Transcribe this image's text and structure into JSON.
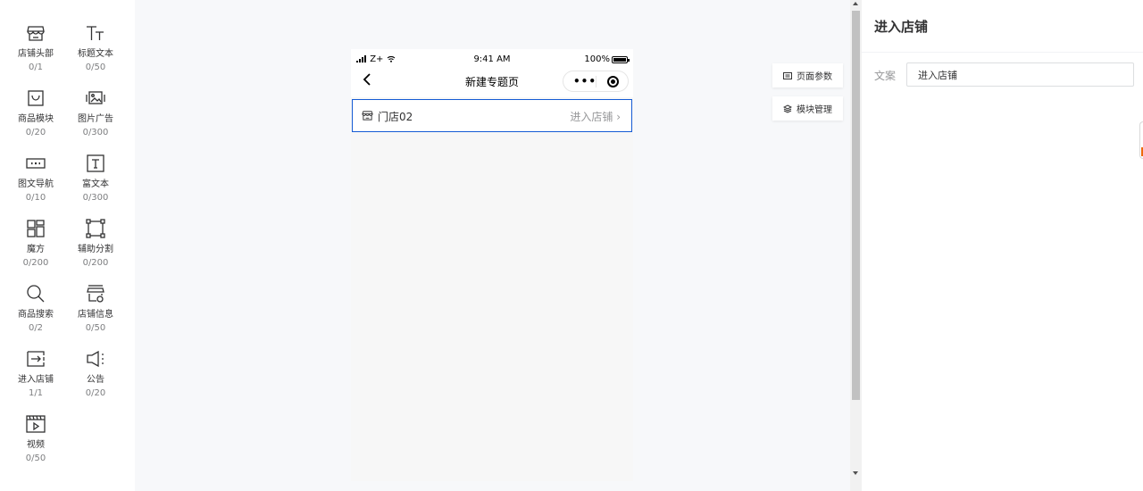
{
  "components": [
    {
      "icon": "storefront-icon",
      "label": "店铺头部",
      "count": "0/1"
    },
    {
      "icon": "title-text-icon",
      "label": "标题文本",
      "count": "0/50"
    },
    {
      "icon": "shopping-bag-icon",
      "label": "商品模块",
      "count": "0/20"
    },
    {
      "icon": "image-ad-icon",
      "label": "图片广告",
      "count": "0/300"
    },
    {
      "icon": "image-nav-icon",
      "label": "图文导航",
      "count": "0/10"
    },
    {
      "icon": "rich-text-icon",
      "label": "富文本",
      "count": "0/300"
    },
    {
      "icon": "magic-cube-icon",
      "label": "魔方",
      "count": "0/200"
    },
    {
      "icon": "divider-icon",
      "label": "辅助分割",
      "count": "0/200"
    },
    {
      "icon": "search-icon",
      "label": "商品搜索",
      "count": "0/2"
    },
    {
      "icon": "store-info-icon",
      "label": "店铺信息",
      "count": "0/50"
    },
    {
      "icon": "enter-store-icon",
      "label": "进入店铺",
      "count": "1/1"
    },
    {
      "icon": "megaphone-icon",
      "label": "公告",
      "count": "0/20"
    },
    {
      "icon": "video-icon",
      "label": "视频",
      "count": "0/50"
    }
  ],
  "phone": {
    "status": {
      "signal": "Z+",
      "time": "9:41 AM",
      "battery": "100%"
    },
    "nav_title": "新建专题页",
    "capsule_dots": "•••",
    "store": {
      "name": "门店02",
      "link_text": "进入店铺",
      "chevron": "›"
    }
  },
  "side_buttons": {
    "page_params": "页面参数",
    "module_manage": "模块管理"
  },
  "right_panel": {
    "title": "进入店铺",
    "field_label": "文案",
    "field_value": "进入店铺"
  },
  "colors": {
    "accent": "#155bd4",
    "text": "#323233",
    "muted": "#969799",
    "warning": "#ed6a0c"
  }
}
